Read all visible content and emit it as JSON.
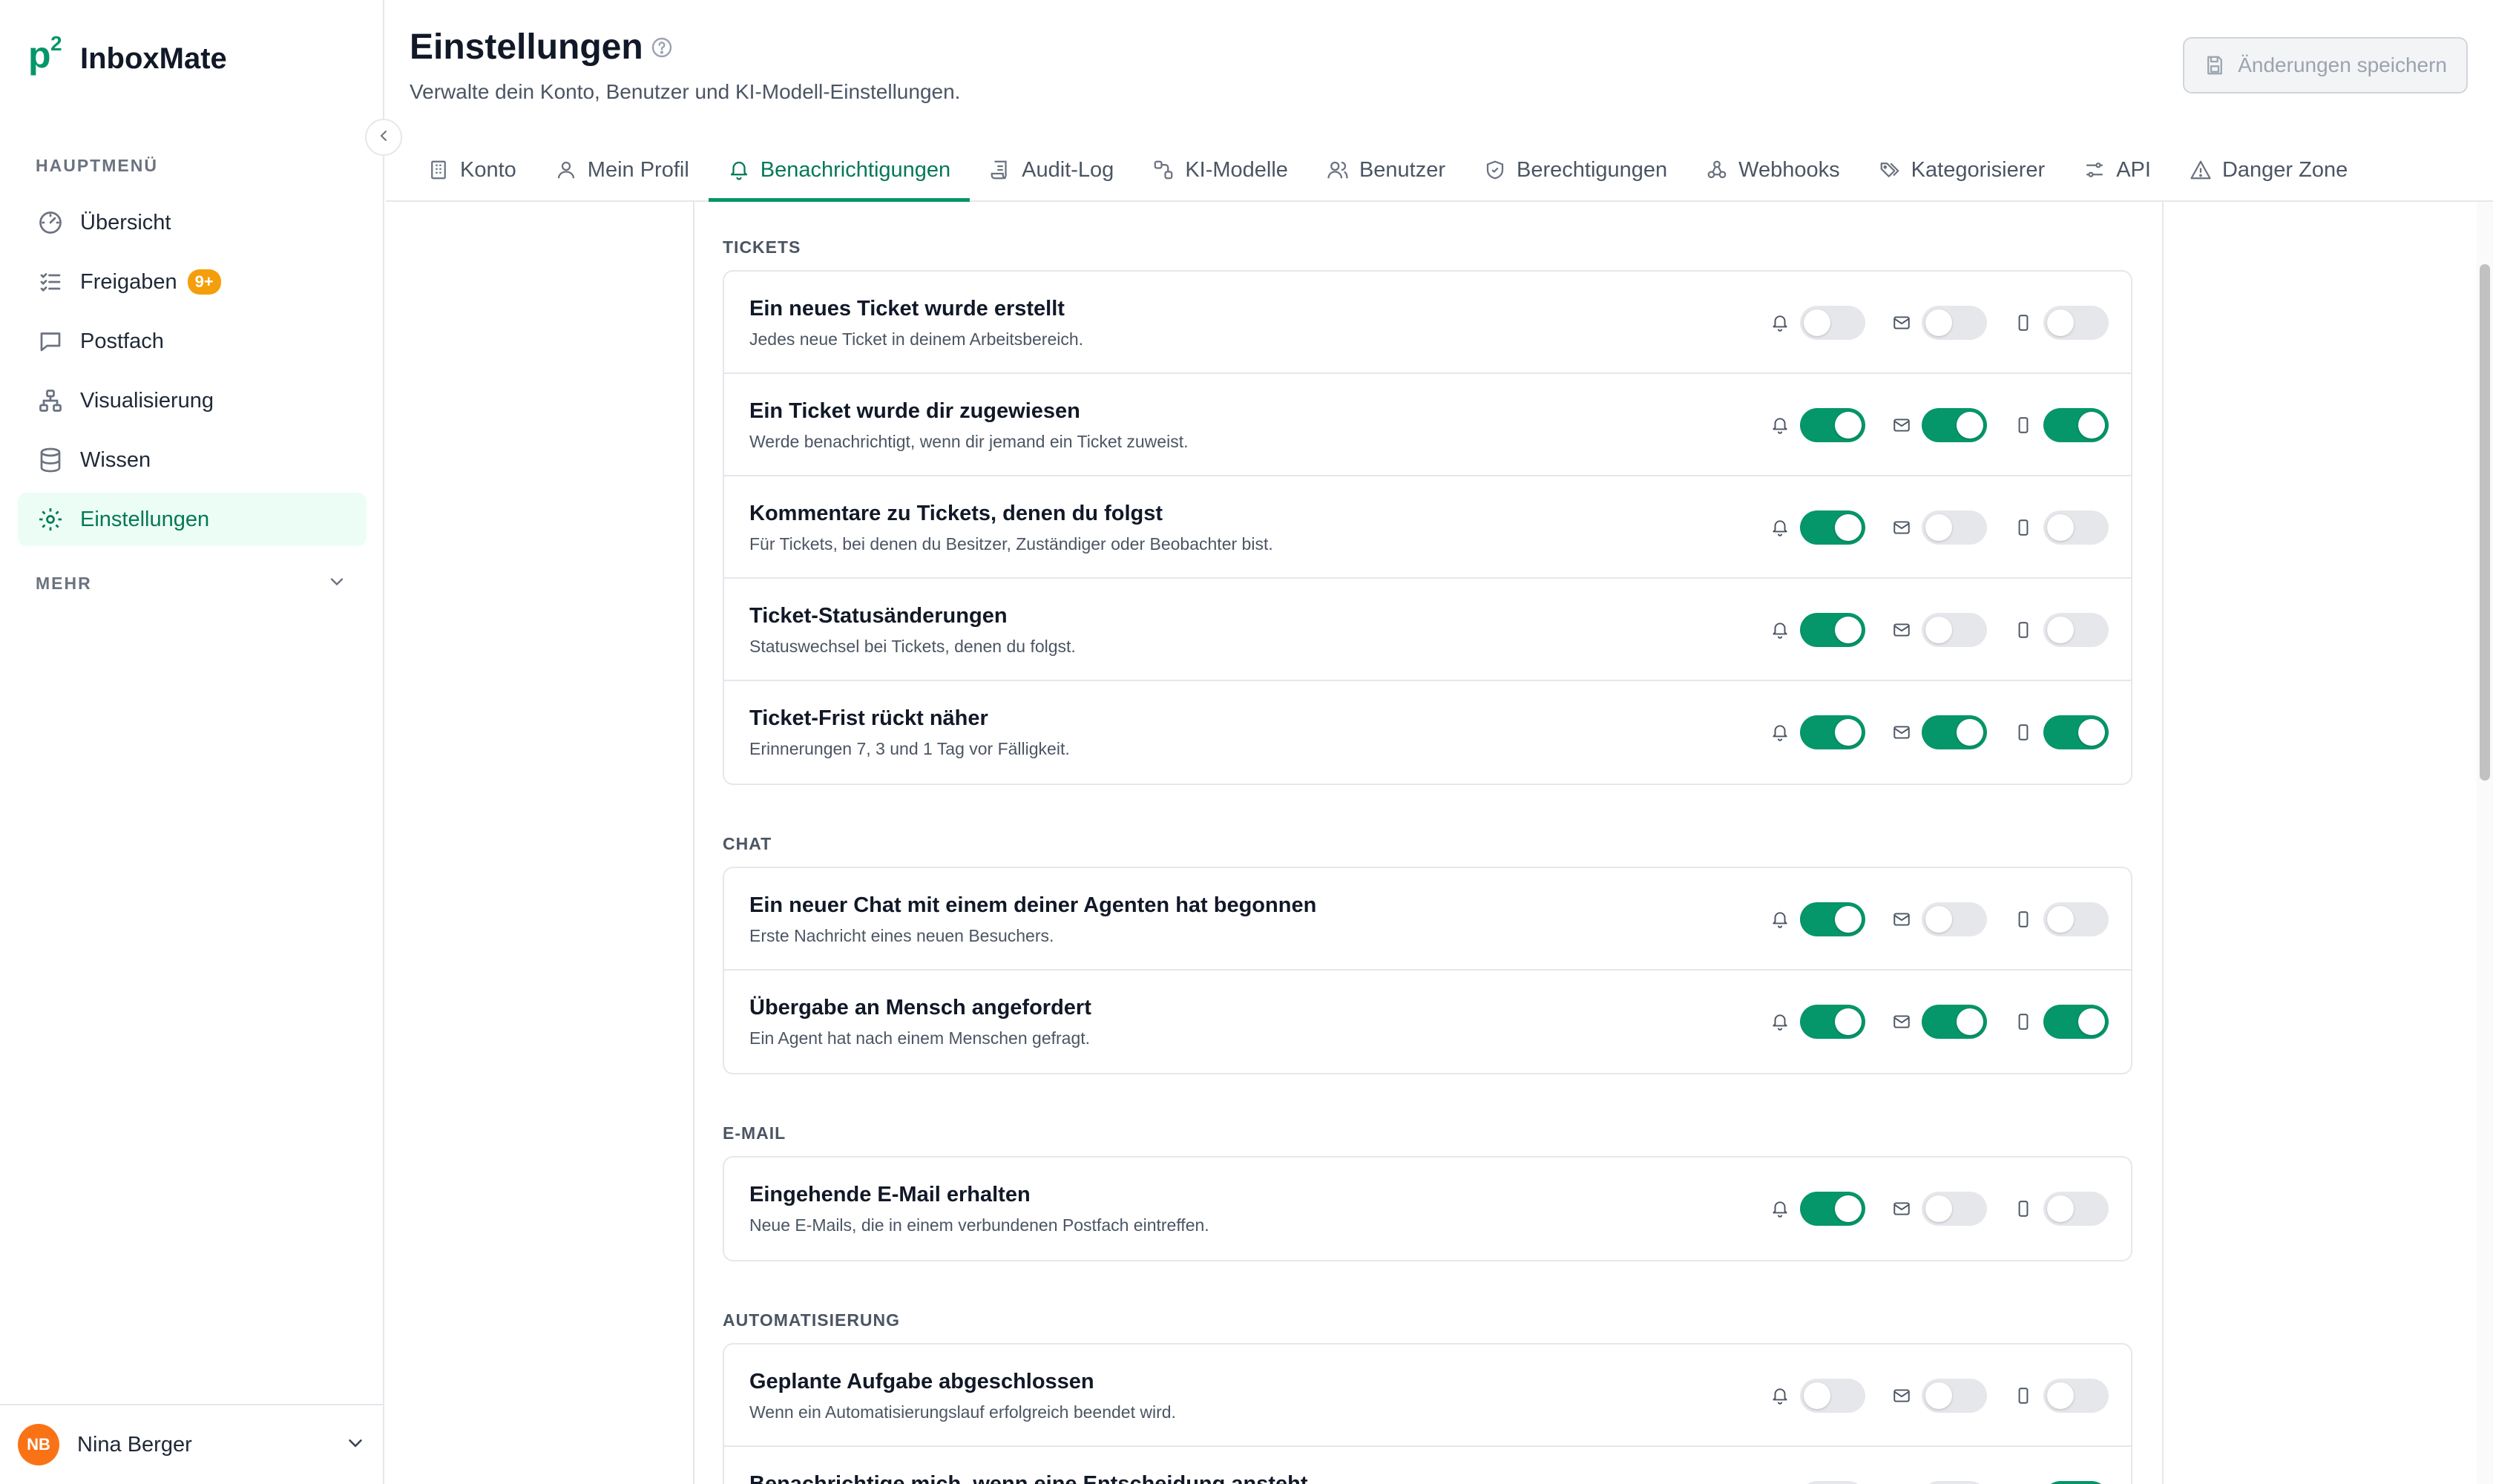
{
  "brand": {
    "mark": "p",
    "mark_sup": "2",
    "name": "InboxMate"
  },
  "sidebar": {
    "section_main": "HAUPTMENÜ",
    "items": [
      {
        "label": "Übersicht",
        "icon": "gauge-icon"
      },
      {
        "label": "Freigaben",
        "icon": "checklist-icon",
        "badge": "9+"
      },
      {
        "label": "Postfach",
        "icon": "message-icon"
      },
      {
        "label": "Visualisierung",
        "icon": "hierarchy-icon"
      },
      {
        "label": "Wissen",
        "icon": "database-icon"
      },
      {
        "label": "Einstellungen",
        "icon": "gear-icon",
        "active": true
      }
    ],
    "section_more": "MEHR"
  },
  "user": {
    "initials": "NB",
    "name": "Nina Berger"
  },
  "header": {
    "title": "Einstellungen",
    "subtitle": "Verwalte dein Konto, Benutzer und KI-Modell-Einstellungen.",
    "save_label": "Änderungen speichern"
  },
  "tabs": [
    {
      "label": "Konto",
      "icon": "building-icon"
    },
    {
      "label": "Mein Profil",
      "icon": "user-icon"
    },
    {
      "label": "Benachrichtigungen",
      "icon": "bell-icon",
      "active": true
    },
    {
      "label": "Audit-Log",
      "icon": "scroll-icon"
    },
    {
      "label": "KI-Modelle",
      "icon": "nodes-icon"
    },
    {
      "label": "Benutzer",
      "icon": "users-icon"
    },
    {
      "label": "Berechtigungen",
      "icon": "shield-icon"
    },
    {
      "label": "Webhooks",
      "icon": "webhook-icon"
    },
    {
      "label": "Kategorisierer",
      "icon": "tags-icon"
    },
    {
      "label": "API",
      "icon": "sliders-icon"
    },
    {
      "label": "Danger Zone",
      "icon": "warning-icon"
    }
  ],
  "groups": [
    {
      "label": "TICKETS",
      "rows": [
        {
          "title": "Ein neues Ticket wurde erstellt",
          "desc": "Jedes neue Ticket in deinem Arbeitsbereich.",
          "inapp": false,
          "email": false,
          "mobile": false
        },
        {
          "title": "Ein Ticket wurde dir zugewiesen",
          "desc": "Werde benachrichtigt, wenn dir jemand ein Ticket zuweist.",
          "inapp": true,
          "email": true,
          "mobile": true
        },
        {
          "title": "Kommentare zu Tickets, denen du folgst",
          "desc": "Für Tickets, bei denen du Besitzer, Zuständiger oder Beobachter bist.",
          "inapp": true,
          "email": false,
          "mobile": false
        },
        {
          "title": "Ticket-Statusänderungen",
          "desc": "Statuswechsel bei Tickets, denen du folgst.",
          "inapp": true,
          "email": false,
          "mobile": false
        },
        {
          "title": "Ticket-Frist rückt näher",
          "desc": "Erinnerungen 7, 3 und 1 Tag vor Fälligkeit.",
          "inapp": true,
          "email": true,
          "mobile": true
        }
      ]
    },
    {
      "label": "CHAT",
      "rows": [
        {
          "title": "Ein neuer Chat mit einem deiner Agenten hat begonnen",
          "desc": "Erste Nachricht eines neuen Besuchers.",
          "inapp": true,
          "email": false,
          "mobile": false
        },
        {
          "title": "Übergabe an Mensch angefordert",
          "desc": "Ein Agent hat nach einem Menschen gefragt.",
          "inapp": true,
          "email": true,
          "mobile": true
        }
      ]
    },
    {
      "label": "E-MAIL",
      "rows": [
        {
          "title": "Eingehende E-Mail erhalten",
          "desc": "Neue E-Mails, die in einem verbundenen Postfach eintreffen.",
          "inapp": true,
          "email": false,
          "mobile": false
        }
      ]
    },
    {
      "label": "AUTOMATISIERUNG",
      "rows": [
        {
          "title": "Geplante Aufgabe abgeschlossen",
          "desc": "Wenn ein Automatisierungslauf erfolgreich beendet wird.",
          "inapp": false,
          "email": false,
          "mobile": false
        },
        {
          "title": "Benachrichtige mich, wenn eine Entscheidung ansteht",
          "desc": "",
          "inapp": false,
          "email": false,
          "mobile": true
        }
      ]
    }
  ],
  "colors": {
    "accent": "#059669",
    "toggle_off": "#e5e7eb",
    "badge": "#f59e0b",
    "avatar": "#f97316"
  }
}
